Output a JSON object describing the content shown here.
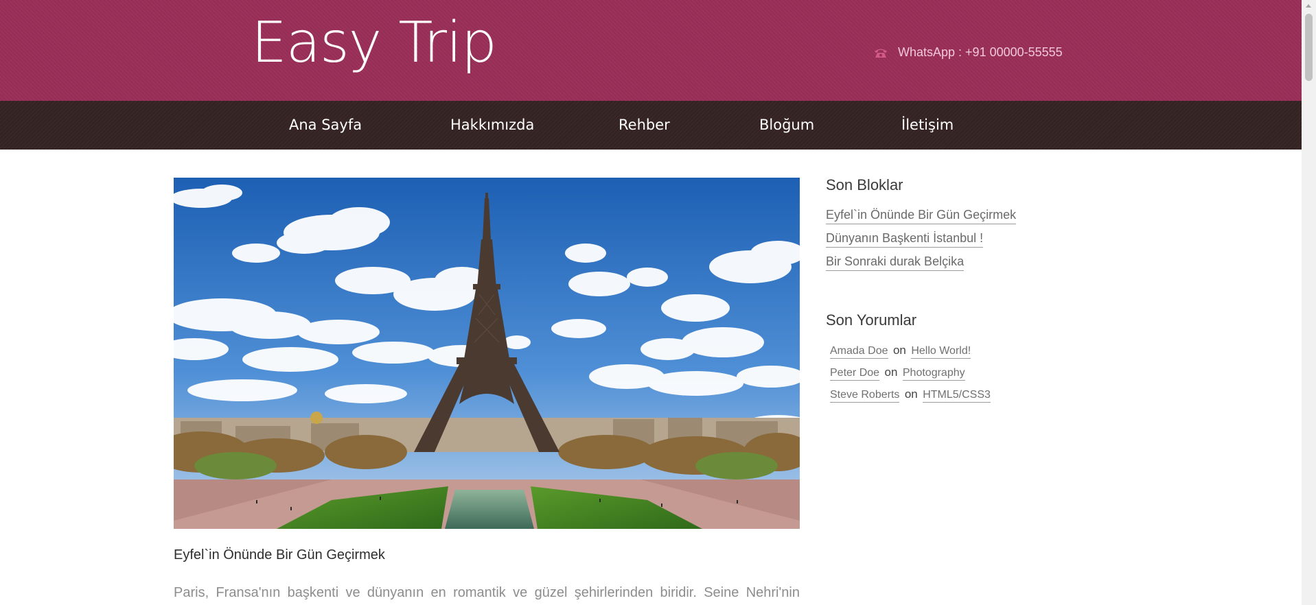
{
  "header": {
    "logo": "Easy Trip",
    "contact": "WhatsApp : +91 00000-55555",
    "contact_icon": "phone-icon",
    "brand_color": "#9a2e58"
  },
  "nav": {
    "items": [
      {
        "label": "Ana Sayfa"
      },
      {
        "label": "Hakkımızda"
      },
      {
        "label": "Rehber"
      },
      {
        "label": "Bloğum"
      },
      {
        "label": "İletişim"
      }
    ],
    "background_color": "#362424"
  },
  "main": {
    "post": {
      "image": "eiffel-tower-photo",
      "title": "Eyfel`in Önünde Bir Gün Geçirmek",
      "excerpt": "Paris, Fransa'nın başkenti ve dünyanın en romantik ve güzel şehirlerinden biridir. Seine Nehri'nin"
    }
  },
  "sidebar": {
    "recent_posts": {
      "title": "Son Bloklar",
      "items": [
        {
          "label": "Eyfel`in Önünde Bir Gün Geçirmek"
        },
        {
          "label": "Dünyanın Başkenti İstanbul !"
        },
        {
          "label": "Bir Sonraki durak Belçika"
        }
      ]
    },
    "recent_comments": {
      "title": "Son Yorumlar",
      "items": [
        {
          "author": "Amada Doe",
          "sep": "on",
          "post": "Hello World!"
        },
        {
          "author": "Peter Doe",
          "sep": "on",
          "post": "Photography"
        },
        {
          "author": "Steve Roberts",
          "sep": "on",
          "post": "HTML5/CSS3"
        }
      ]
    }
  }
}
